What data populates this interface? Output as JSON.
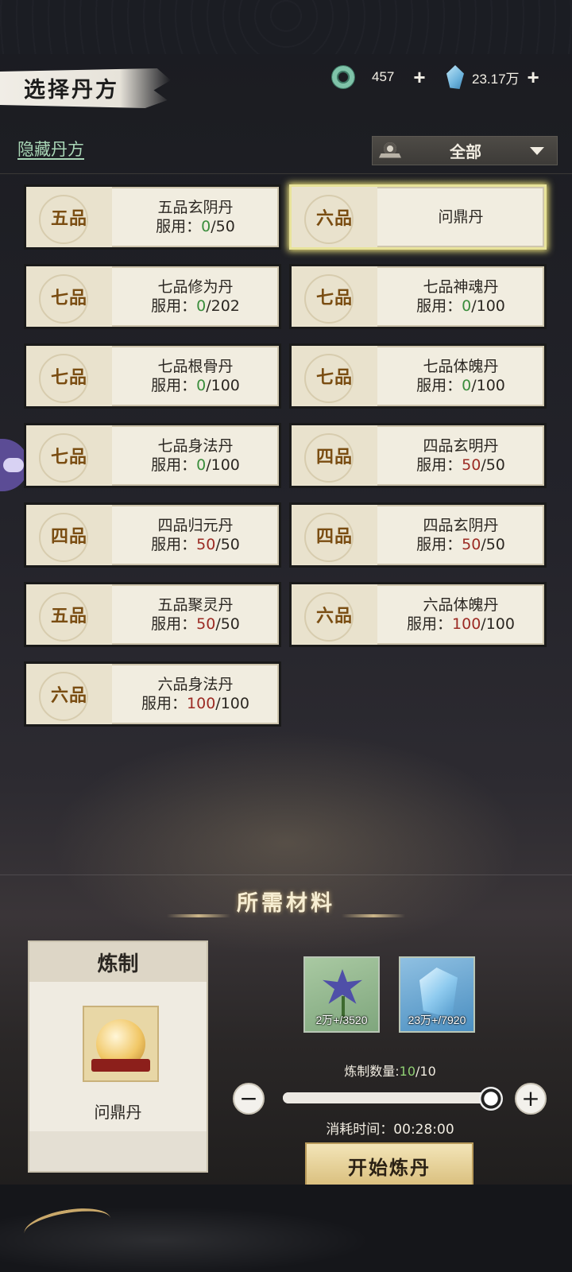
{
  "header": {
    "title": "选择丹方",
    "jade_amount": "457",
    "crystal_amount": "23.17万",
    "plus": "+"
  },
  "filter_bar": {
    "hide_link": "隐藏丹方",
    "filter_selected": "全部"
  },
  "usage_prefix": "服用：",
  "recipes": [
    {
      "grade": "五品",
      "name": "五品玄阴丹",
      "used": "0",
      "total": "/50",
      "state": "none"
    },
    {
      "grade": "六品",
      "name": "问鼎丹",
      "used": "",
      "total": "",
      "state": "selected"
    },
    {
      "grade": "七品",
      "name": "七品修为丹",
      "used": "0",
      "total": "/202",
      "state": "none"
    },
    {
      "grade": "七品",
      "name": "七品神魂丹",
      "used": "0",
      "total": "/100",
      "state": "none"
    },
    {
      "grade": "七品",
      "name": "七品根骨丹",
      "used": "0",
      "total": "/100",
      "state": "none"
    },
    {
      "grade": "七品",
      "name": "七品体魄丹",
      "used": "0",
      "total": "/100",
      "state": "none"
    },
    {
      "grade": "七品",
      "name": "七品身法丹",
      "used": "0",
      "total": "/100",
      "state": "none"
    },
    {
      "grade": "四品",
      "name": "四品玄明丹",
      "used": "50",
      "total": "/50",
      "state": "full"
    },
    {
      "grade": "四品",
      "name": "四品归元丹",
      "used": "50",
      "total": "/50",
      "state": "full"
    },
    {
      "grade": "四品",
      "name": "四品玄阴丹",
      "used": "50",
      "total": "/50",
      "state": "full"
    },
    {
      "grade": "五品",
      "name": "五品聚灵丹",
      "used": "50",
      "total": "/50",
      "state": "full"
    },
    {
      "grade": "六品",
      "name": "六品体魄丹",
      "used": "100",
      "total": "/100",
      "state": "full"
    },
    {
      "grade": "六品",
      "name": "六品身法丹",
      "used": "100",
      "total": "/100",
      "state": "full"
    }
  ],
  "materials": {
    "title": "所需材料",
    "craft_header": "炼制",
    "craft_item_name": "问鼎丹",
    "herb_count": "2万+/3520",
    "stone_count": "23万+/7920",
    "qty_label": "炼制数量:",
    "qty_current": "10",
    "qty_max": "/10",
    "qty_fraction": 1.0,
    "minus": "−",
    "plus": "+",
    "time_label": "消耗时间：00:28:00",
    "start_button": "开始炼丹"
  },
  "colors": {
    "used_zero": "#3a8d3c",
    "used_full": "#9c2b24",
    "grade_text": "#7a4d12"
  }
}
